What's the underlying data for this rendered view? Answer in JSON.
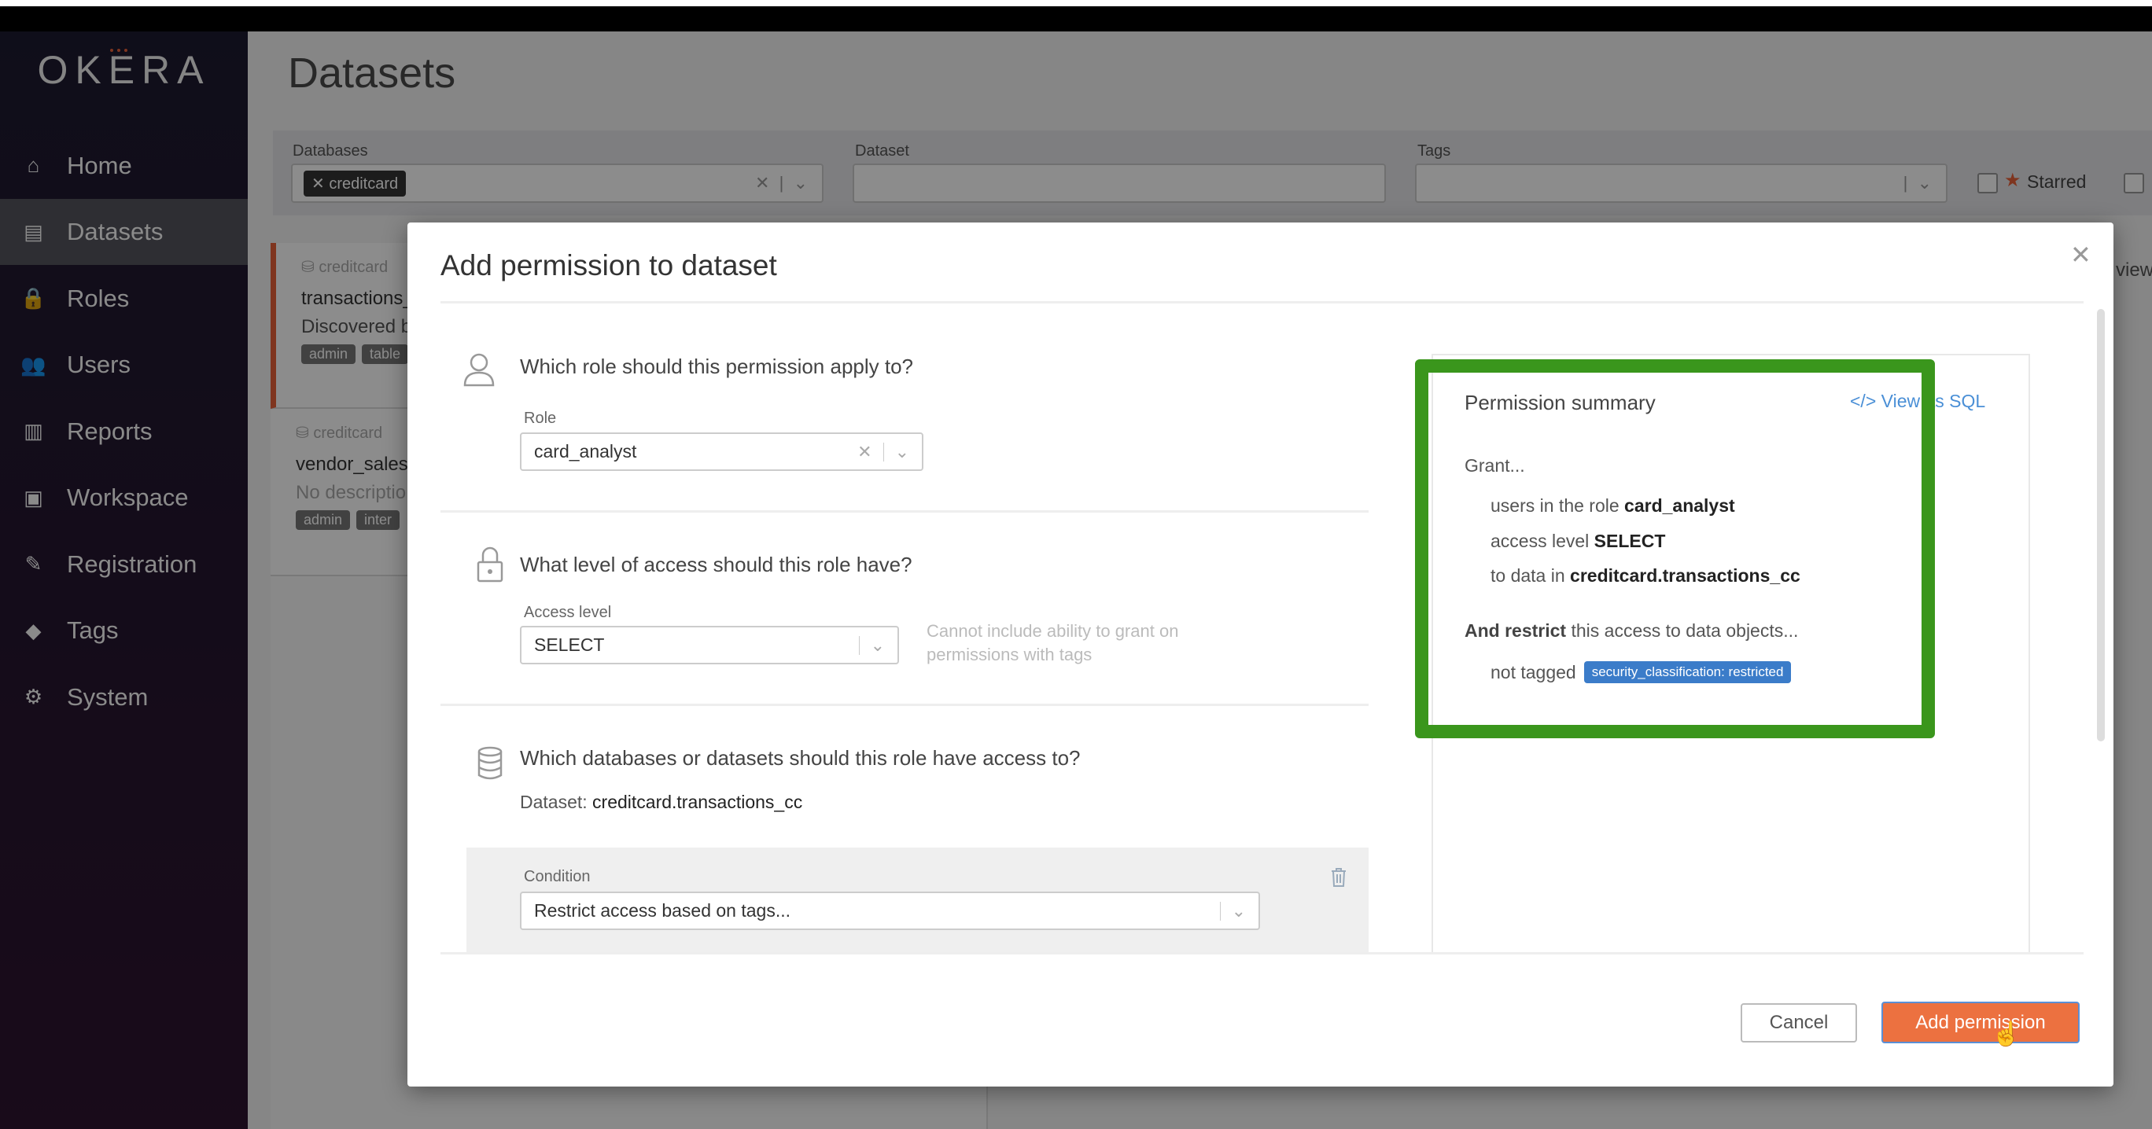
{
  "app": {
    "logo": "OKERA",
    "page_title": "Datasets"
  },
  "sidebar": {
    "items": [
      {
        "label": "Home",
        "icon": "home-icon",
        "glyph": "⌂"
      },
      {
        "label": "Datasets",
        "icon": "datasets-icon",
        "glyph": "▤",
        "active": true
      },
      {
        "label": "Roles",
        "icon": "lock-icon",
        "glyph": "🔒"
      },
      {
        "label": "Users",
        "icon": "users-icon",
        "glyph": "👥"
      },
      {
        "label": "Reports",
        "icon": "bar-chart-icon",
        "glyph": "▥"
      },
      {
        "label": "Workspace",
        "icon": "terminal-icon",
        "glyph": "▣"
      },
      {
        "label": "Registration",
        "icon": "edit-icon",
        "glyph": "✎"
      },
      {
        "label": "Tags",
        "icon": "tag-icon",
        "glyph": "◆"
      },
      {
        "label": "System",
        "icon": "gear-icon",
        "glyph": "⚙"
      }
    ]
  },
  "filters": {
    "databases_label": "Databases",
    "databases_chip": "creditcard",
    "dataset_label": "Dataset",
    "tags_label": "Tags",
    "starred_label": "Starred"
  },
  "cards": [
    {
      "db": "creditcard",
      "name": "transactions_",
      "desc": "Discovered b",
      "tags": [
        "admin",
        "table"
      ]
    },
    {
      "db": "creditcard",
      "name": "vendor_sales",
      "desc": "No descriptio",
      "tags": [
        "admin",
        "inter"
      ]
    }
  ],
  "background_view_fragment": "view",
  "modal": {
    "title": "Add permission to dataset",
    "role": {
      "question": "Which role should this permission apply to?",
      "label": "Role",
      "value": "card_analyst"
    },
    "access": {
      "question": "What level of access should this role have?",
      "label": "Access level",
      "value": "SELECT",
      "hint_line1": "Cannot include ability to grant on",
      "hint_line2": "permissions with tags"
    },
    "data": {
      "question": "Which databases or datasets should this role have access to?",
      "dataset_prefix": "Dataset:",
      "dataset_value": "creditcard.transactions_cc"
    },
    "condition": {
      "label": "Condition",
      "value": "Restrict access based on tags..."
    },
    "summary": {
      "title": "Permission summary",
      "view_sql": "View as SQL",
      "grant": "Grant...",
      "role_prefix": "users in the role",
      "role_value": "card_analyst",
      "access_prefix": "access level",
      "access_value": "SELECT",
      "data_prefix": "to data in",
      "data_value": "creditcard.transactions_cc",
      "restrict_bold": "And restrict",
      "restrict_rest": "this access to data objects...",
      "not_tagged": "not tagged",
      "tag": "security_classification: restricted"
    },
    "cancel": "Cancel",
    "submit": "Add permission"
  },
  "colors": {
    "accent": "#ec7140",
    "highlight": "#3a961c",
    "tag": "#3b7cc9",
    "link": "#4a8fd6"
  }
}
